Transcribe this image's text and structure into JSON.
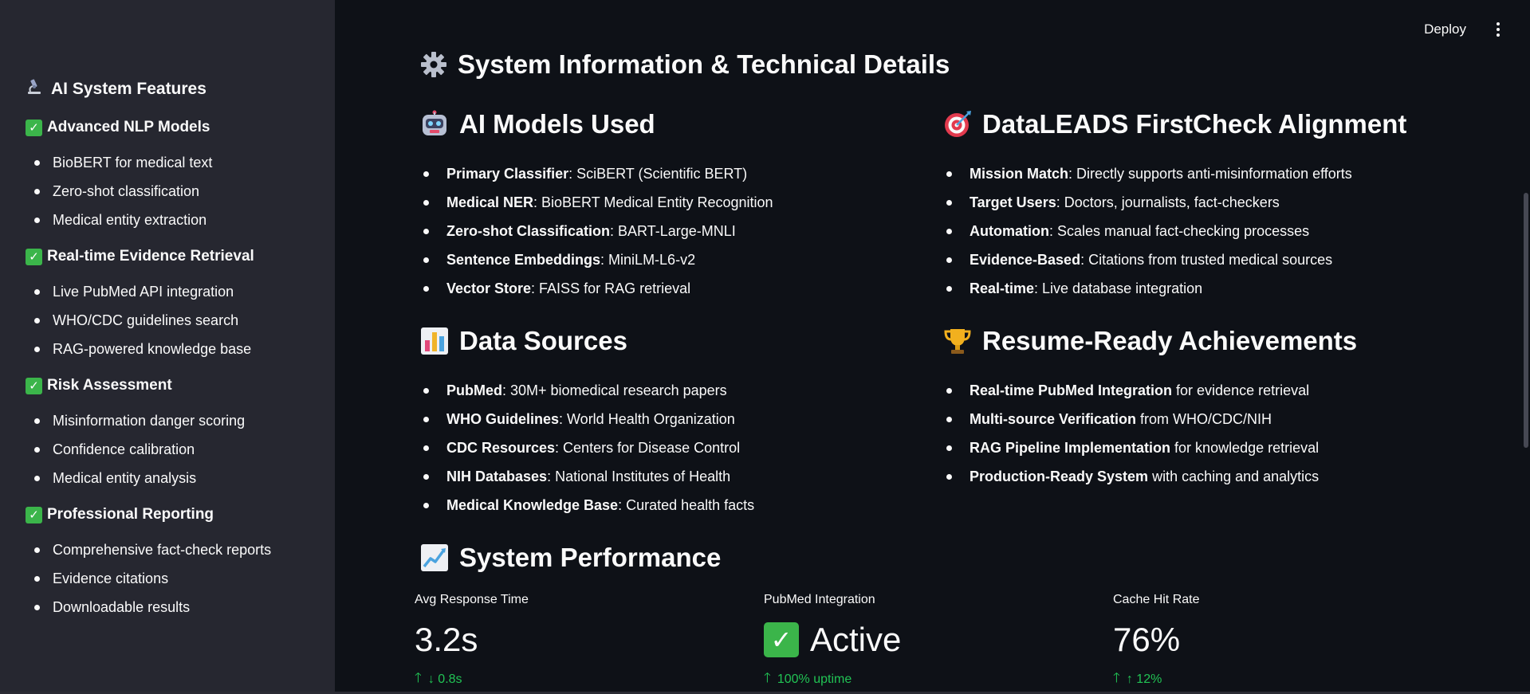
{
  "sidebar": {
    "title": "AI System Features",
    "title_icon": "microscope-icon",
    "sections": [
      {
        "heading": "Advanced NLP Models",
        "items": [
          "BioBERT for medical text",
          "Zero-shot classification",
          "Medical entity extraction"
        ]
      },
      {
        "heading": "Real-time Evidence Retrieval",
        "items": [
          "Live PubMed API integration",
          "WHO/CDC guidelines search",
          "RAG-powered knowledge base"
        ]
      },
      {
        "heading": "Risk Assessment",
        "items": [
          "Misinformation danger scoring",
          "Confidence calibration",
          "Medical entity analysis"
        ]
      },
      {
        "heading": "Professional Reporting",
        "items": [
          "Comprehensive fact-check reports",
          "Evidence citations",
          "Downloadable results"
        ]
      }
    ]
  },
  "toolbar": {
    "deploy_label": "Deploy"
  },
  "page": {
    "title": "System Information & Technical Details",
    "title_icon": "gear-icon"
  },
  "models": {
    "title": "AI Models Used",
    "icon": "robot-icon",
    "items": [
      {
        "key": "Primary Classifier",
        "value": ": SciBERT (Scientific BERT)"
      },
      {
        "key": "Medical NER",
        "value": ": BioBERT Medical Entity Recognition"
      },
      {
        "key": "Zero-shot Classification",
        "value": ": BART-Large-MNLI"
      },
      {
        "key": "Sentence Embeddings",
        "value": ": MiniLM-L6-v2"
      },
      {
        "key": "Vector Store",
        "value": ": FAISS for RAG retrieval"
      }
    ]
  },
  "alignment": {
    "title": "DataLEADS FirstCheck Alignment",
    "icon": "target-icon",
    "items": [
      {
        "key": "Mission Match",
        "value": ": Directly supports anti-misinformation efforts"
      },
      {
        "key": "Target Users",
        "value": ": Doctors, journalists, fact-checkers"
      },
      {
        "key": "Automation",
        "value": ": Scales manual fact-checking processes"
      },
      {
        "key": "Evidence-Based",
        "value": ": Citations from trusted medical sources"
      },
      {
        "key": "Real-time",
        "value": ": Live database integration"
      }
    ]
  },
  "sources": {
    "title": "Data Sources",
    "icon": "bar-chart-icon",
    "items": [
      {
        "key": "PubMed",
        "value": ": 30M+ biomedical research papers"
      },
      {
        "key": "WHO Guidelines",
        "value": ": World Health Organization"
      },
      {
        "key": "CDC Resources",
        "value": ": Centers for Disease Control"
      },
      {
        "key": "NIH Databases",
        "value": ": National Institutes of Health"
      },
      {
        "key": "Medical Knowledge Base",
        "value": ": Curated health facts"
      }
    ]
  },
  "achievements": {
    "title": "Resume-Ready Achievements",
    "icon": "trophy-icon",
    "items": [
      {
        "key": "Real-time PubMed Integration",
        "value": " for evidence retrieval"
      },
      {
        "key": "Multi-source Verification",
        "value": " from WHO/CDC/NIH"
      },
      {
        "key": "RAG Pipeline Implementation",
        "value": " for knowledge retrieval"
      },
      {
        "key": "Production-Ready System",
        "value": " with caching and analytics"
      }
    ]
  },
  "performance": {
    "title": "System Performance",
    "icon": "chart-increasing-icon",
    "metrics": [
      {
        "label": "Avg Response Time",
        "value": "3.2s",
        "delta": "↓ 0.8s"
      },
      {
        "label": "PubMed Integration",
        "value": "Active",
        "delta": "100% uptime"
      },
      {
        "label": "Cache Hit Rate",
        "value": "76%",
        "delta": "↑ 12%"
      }
    ]
  },
  "colors": {
    "background": "#0e1117",
    "sidebar": "#262730",
    "check": "#3bb54a",
    "delta": "#21c354"
  }
}
